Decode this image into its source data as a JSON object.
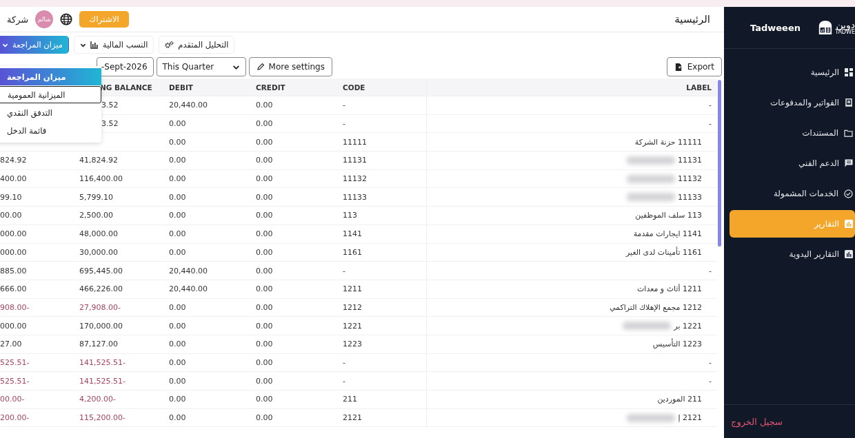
{
  "header": {
    "title": "الرئيسية",
    "subscribe": "الاشتراك",
    "avatar": "شالم",
    "company": "شركة"
  },
  "reports_toolbar": [
    {
      "label": "التحليل المتقدم",
      "kind": "action",
      "selected": false
    },
    {
      "label": "النسب المالية",
      "kind": "menu",
      "selected": false
    },
    {
      "label": "ميزان المراجعة",
      "kind": "menu",
      "selected": true
    }
  ],
  "report_menu": [
    {
      "label": "ميزان المراجعة",
      "selected": true,
      "hovered": false
    },
    {
      "label": "الميزانية العمومية",
      "selected": false,
      "hovered": true
    },
    {
      "label": "التدفق النقدي",
      "selected": false,
      "hovered": false
    },
    {
      "label": "قائمة الدخل",
      "selected": false,
      "hovered": false
    }
  ],
  "filters": {
    "date": "-Sept-2026",
    "period": "This Quarter",
    "more": "More settings",
    "export": "Export"
  },
  "table": {
    "columns": [
      "NG BALANCE",
      "DEBIT",
      "CREDIT",
      "CODE",
      "LABEL"
    ],
    "rows": [
      {
        "kind": "group",
        "balance": "3.52",
        "debit": "20,440.00",
        "credit": "0.00",
        "code": "-",
        "label": "-",
        "negative": false,
        "redacted": false
      },
      {
        "kind": "group",
        "balance": "3.52",
        "debit": "0.00",
        "credit": "0.00",
        "code": "-",
        "label": "-",
        "negative": false,
        "redacted": false
      },
      {
        "kind": "account",
        "debit": "0.00",
        "credit": "0.00",
        "code": "11111",
        "label": "11111 حزنة الشركة",
        "redacted": false
      },
      {
        "kind": "account",
        "column_1": "824.92",
        "balance": "41,824.92",
        "debit": "0.00",
        "credit": "0.00",
        "code": "11131",
        "label": "11131",
        "negative": false,
        "redacted": true
      },
      {
        "kind": "account",
        "column_1": "400.00",
        "balance": "116,400.00",
        "debit": "0.00",
        "credit": "0.00",
        "code": "11132",
        "label": "11132",
        "negative": false,
        "redacted": true
      },
      {
        "kind": "account",
        "column_1": "99.10",
        "balance": "5,799.10",
        "debit": "0.00",
        "credit": "0.00",
        "code": "11133",
        "label": "11133",
        "negative": false,
        "redacted": true
      },
      {
        "kind": "account",
        "column_1": "00.00",
        "balance": "2,500.00",
        "debit": "0.00",
        "credit": "0.00",
        "code": "113",
        "label": "113 سلف الموظفين",
        "negative": false,
        "redacted": false
      },
      {
        "kind": "account",
        "column_1": "000.00",
        "balance": "48,000.00",
        "debit": "0.00",
        "credit": "0.00",
        "code": "1141",
        "label": "1141 ايجارات مقدمة",
        "negative": false,
        "redacted": false
      },
      {
        "kind": "account",
        "column_1": "000.00",
        "balance": "30,000.00",
        "debit": "0.00",
        "credit": "0.00",
        "code": "1161",
        "label": "1161 تأمينات لدى الغير",
        "negative": false,
        "redacted": false
      },
      {
        "kind": "group",
        "column_1": "885.00",
        "balance": "695,445.00",
        "debit": "20,440.00",
        "credit": "0.00",
        "code": "-",
        "label": "-",
        "negative": false,
        "redacted": false
      },
      {
        "kind": "account",
        "column_1": "666.00",
        "balance": "466,226.00",
        "debit": "20,440.00",
        "credit": "0.00",
        "code": "1211",
        "label": "1211 أثاث و معدات",
        "negative": false,
        "redacted": false
      },
      {
        "kind": "account",
        "column_1": "908.00-",
        "balance": "27,908.00-",
        "debit": "0.00",
        "credit": "0.00",
        "code": "1212",
        "label": "1212 مجمع الإهلاك التراكمي",
        "negative": true,
        "redacted": false
      },
      {
        "kind": "account",
        "column_1": "000.00",
        "balance": "170,000.00",
        "debit": "0.00",
        "credit": "0.00",
        "code": "1221",
        "label": "1221 بر",
        "negative": false,
        "redacted": true
      },
      {
        "kind": "account",
        "column_1": "27.00",
        "balance": "87,127.00",
        "debit": "0.00",
        "credit": "0.00",
        "code": "1223",
        "label": "1223 التأسيس",
        "negative": false,
        "redacted": false
      },
      {
        "kind": "group",
        "column_1": "525.51-",
        "balance": "141,525.51-",
        "debit": "0.00",
        "credit": "0.00",
        "code": "-",
        "label": "-",
        "negative": true,
        "redacted": false
      },
      {
        "kind": "group",
        "column_1": "525.51-",
        "balance": "141,525.51-",
        "debit": "0.00",
        "credit": "0.00",
        "code": "-",
        "label": "-",
        "negative": true,
        "redacted": false
      },
      {
        "kind": "account",
        "column_1": "00.00-",
        "balance": "4,200.00-",
        "debit": "0.00",
        "credit": "0.00",
        "code": "211",
        "label": "211 الموردين",
        "negative": true,
        "redacted": false
      },
      {
        "kind": "account",
        "column_1": "200.00-",
        "balance": "115,200.00-",
        "debit": "0.00",
        "credit": "0.00",
        "code": "2121",
        "label": "2121 إ",
        "negative": true,
        "redacted": true
      }
    ]
  },
  "sidebar": {
    "logo_arabic": "دوين",
    "logo_latin": "TADWE",
    "brand": "Tadweeen",
    "items": [
      {
        "label": "الرئيسية",
        "selected": false
      },
      {
        "label": "الفواتير والمدفوعات",
        "selected": false
      },
      {
        "label": "المستندات",
        "selected": false
      },
      {
        "label": "الدعم الفني",
        "selected": false
      },
      {
        "label": "الخدمات المشمولة",
        "selected": false
      },
      {
        "label": "التقارير",
        "selected": true
      },
      {
        "label": "التقارير اليدوية",
        "selected": false
      }
    ],
    "logout": "سجيل الخروج"
  }
}
